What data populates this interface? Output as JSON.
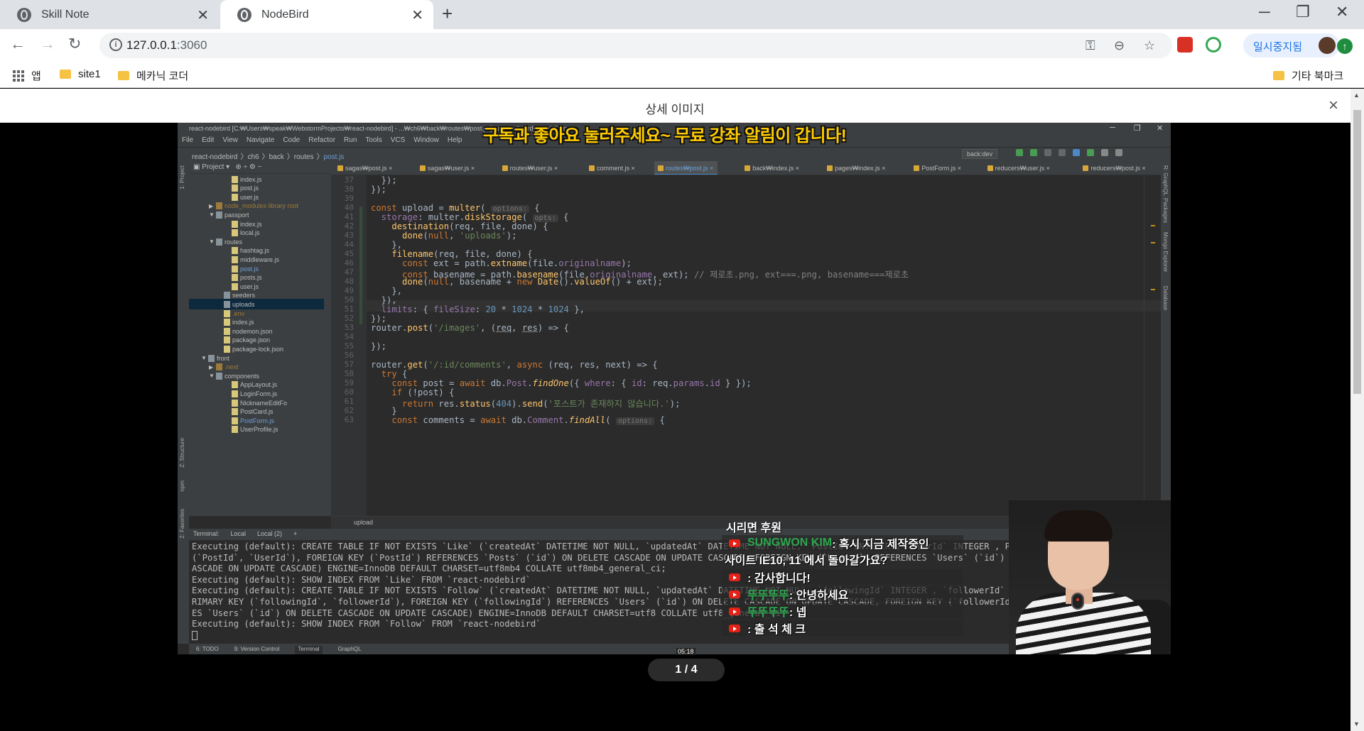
{
  "browser": {
    "tabs": [
      {
        "title": "Skill Note",
        "active": false
      },
      {
        "title": "NodeBird",
        "active": true
      }
    ],
    "new_tab": "+",
    "window_controls": {
      "minimize": "─",
      "restore": "❐",
      "close": "✕"
    },
    "url_host": "127.0.0.1",
    "url_port": ":3060",
    "profile_label": "일시중지됨",
    "bookmarks": [
      {
        "label": "앱",
        "icon": "apps-icon"
      },
      {
        "label": "site1",
        "icon": "folder-icon"
      },
      {
        "label": "메카닉 코더",
        "icon": "folder-icon"
      }
    ],
    "other_bookmarks": "기타 북마크",
    "accent_color": "#1a73e8"
  },
  "page": {
    "header_title": "상세 이미지",
    "close": "×",
    "pager": "1 / 4"
  },
  "ide": {
    "title": "react-nodebird [C:₩Users₩speak₩WebstormProjects₩react-nodebird] - ...₩ch6₩back₩routes₩post.js [react-nodebird] - WebStorm",
    "menu": [
      "File",
      "Edit",
      "View",
      "Navigate",
      "Code",
      "Refactor",
      "Run",
      "Tools",
      "VCS",
      "Window",
      "Help"
    ],
    "breadcrumb": [
      "react-nodebird",
      "ch6",
      "back",
      "routes",
      "post.js"
    ],
    "branch": "back:dev",
    "project_label": "Project",
    "tree": [
      {
        "label": "index.js",
        "indent": 4,
        "type": "file"
      },
      {
        "label": "post.js",
        "indent": 4,
        "type": "file"
      },
      {
        "label": "user.js",
        "indent": 4,
        "type": "file"
      },
      {
        "label": "node_modules  library root",
        "indent": 2,
        "type": "folder-closed",
        "dim": true
      },
      {
        "label": "passport",
        "indent": 2,
        "type": "folder-open"
      },
      {
        "label": "index.js",
        "indent": 4,
        "type": "file"
      },
      {
        "label": "local.js",
        "indent": 4,
        "type": "file"
      },
      {
        "label": "routes",
        "indent": 2,
        "type": "folder-open"
      },
      {
        "label": "hashtag.js",
        "indent": 4,
        "type": "file"
      },
      {
        "label": "middleware.js",
        "indent": 4,
        "type": "file"
      },
      {
        "label": "post.js",
        "indent": 4,
        "type": "file",
        "blue": true
      },
      {
        "label": "posts.js",
        "indent": 4,
        "type": "file"
      },
      {
        "label": "user.js",
        "indent": 4,
        "type": "file"
      },
      {
        "label": "seeders",
        "indent": 3,
        "type": "folder"
      },
      {
        "label": "uploads",
        "indent": 3,
        "type": "folder",
        "selected": true
      },
      {
        "label": ".env",
        "indent": 3,
        "type": "file",
        "dim": true
      },
      {
        "label": "index.js",
        "indent": 3,
        "type": "file"
      },
      {
        "label": "nodemon.json",
        "indent": 3,
        "type": "file"
      },
      {
        "label": "package.json",
        "indent": 3,
        "type": "file"
      },
      {
        "label": "package-lock.json",
        "indent": 3,
        "type": "file"
      },
      {
        "label": "front",
        "indent": 1,
        "type": "folder-open"
      },
      {
        "label": ".next",
        "indent": 2,
        "type": "folder-closed",
        "dim": true
      },
      {
        "label": "components",
        "indent": 2,
        "type": "folder-open"
      },
      {
        "label": "AppLayout.js",
        "indent": 4,
        "type": "file"
      },
      {
        "label": "LoginForm.js",
        "indent": 4,
        "type": "file"
      },
      {
        "label": "NicknameEditFo",
        "indent": 4,
        "type": "file"
      },
      {
        "label": "PostCard.js",
        "indent": 4,
        "type": "file"
      },
      {
        "label": "PostForm.js",
        "indent": 4,
        "type": "file",
        "blue": true
      },
      {
        "label": "UserProfile.js",
        "indent": 4,
        "type": "file"
      }
    ],
    "file_tabs": [
      "sagas₩post.js",
      "sagas₩user.js",
      "routes₩user.js",
      "comment.js",
      "routes₩post.js",
      "back₩index.js",
      "pages₩index.js",
      "PostForm.js",
      "reducers₩user.js",
      "reducers₩post.js"
    ],
    "active_file_tab": 4,
    "line_numbers": [
      "37",
      "38",
      "39",
      "40",
      "41",
      "42",
      "43",
      "44",
      "45",
      "46",
      "47",
      "48",
      "49",
      "50",
      "51",
      "52",
      "53",
      "54",
      "55",
      "56",
      "57",
      "58",
      "59",
      "60",
      "61",
      "62",
      "63"
    ],
    "code_breadcrumb": "upload",
    "terminal_tabs": [
      "Terminal:",
      "Local",
      "Local (2)",
      "+"
    ],
    "terminal_lines": [
      "Executing (default): CREATE TABLE IF NOT EXISTS `Like` (`createdAt` DATETIME NOT NULL, `updatedAt` DATETIME NOT NULL, `PostId` INTEGER , `UserId` INTEGER , PRIMARY KEY",
      "(`PostId`, `UserId`), FOREIGN KEY (`PostId`) REFERENCES `Posts` (`id`) ON DELETE CASCADE ON UPDATE CASCADE, FOREIGN KEY (`UserId`) REFERENCES `Users` (`id`) ON DELETE C",
      "ASCADE ON UPDATE CASCADE) ENGINE=InnoDB DEFAULT CHARSET=utf8mb4 COLLATE utf8mb4_general_ci;",
      "Executing (default): SHOW INDEX FROM `Like` FROM `react-nodebird`",
      "Executing (default): CREATE TABLE IF NOT EXISTS `Follow` (`createdAt` DATETIME NOT NULL, `updatedAt` DATETIME NOT NULL, `followingId` INTEGER , `followerId` INTEGER , P",
      "RIMARY KEY (`followingId`, `followerId`), FOREIGN KEY (`followingId`) REFERENCES `Users` (`id`) ON DELETE CASCADE ON UPDATE CASCADE, FOREIGN KEY (`followerId`) REFERENC",
      "ES `Users` (`id`) ON DELETE CASCADE ON UPDATE CASCADE) ENGINE=InnoDB DEFAULT CHARSET=utf8 COLLATE utf8_general_ci;",
      "Executing (default): SHOW INDEX FROM `Follow` FROM `react-nodebird`"
    ],
    "bottom_tools": [
      "6: TODO",
      "9: Version Control",
      "Terminal",
      "GraphQL"
    ],
    "side_tools_left": [
      "1: Project",
      "Z: Structure",
      "npm",
      "2: Favorites"
    ],
    "side_tools_right": [
      "R: GraphQL",
      "Packages",
      "Mongo Explorer",
      "Database"
    ]
  },
  "stream": {
    "banner": "구독과 좋아요 눌러주세요~ 무료 강좌 알림이 갑니다!",
    "donation_title": "시리면 후원",
    "chat": [
      {
        "name": "SUNGWON KIM",
        "message": ": 혹시 지금 제작중인"
      },
      {
        "name": "",
        "message": "사이트 IE10, 11 에서 돌아갈가요?"
      },
      {
        "name": "",
        "message": ": 감사합니다!"
      },
      {
        "name": "뚜뚜뚜뚜",
        "message": ": 안녕하세요"
      },
      {
        "name": "뚜뚜뚜뚜",
        "message": ": 넵"
      },
      {
        "name": "",
        "message": ": 출 석 체 크"
      }
    ],
    "timecode": "05:18"
  }
}
